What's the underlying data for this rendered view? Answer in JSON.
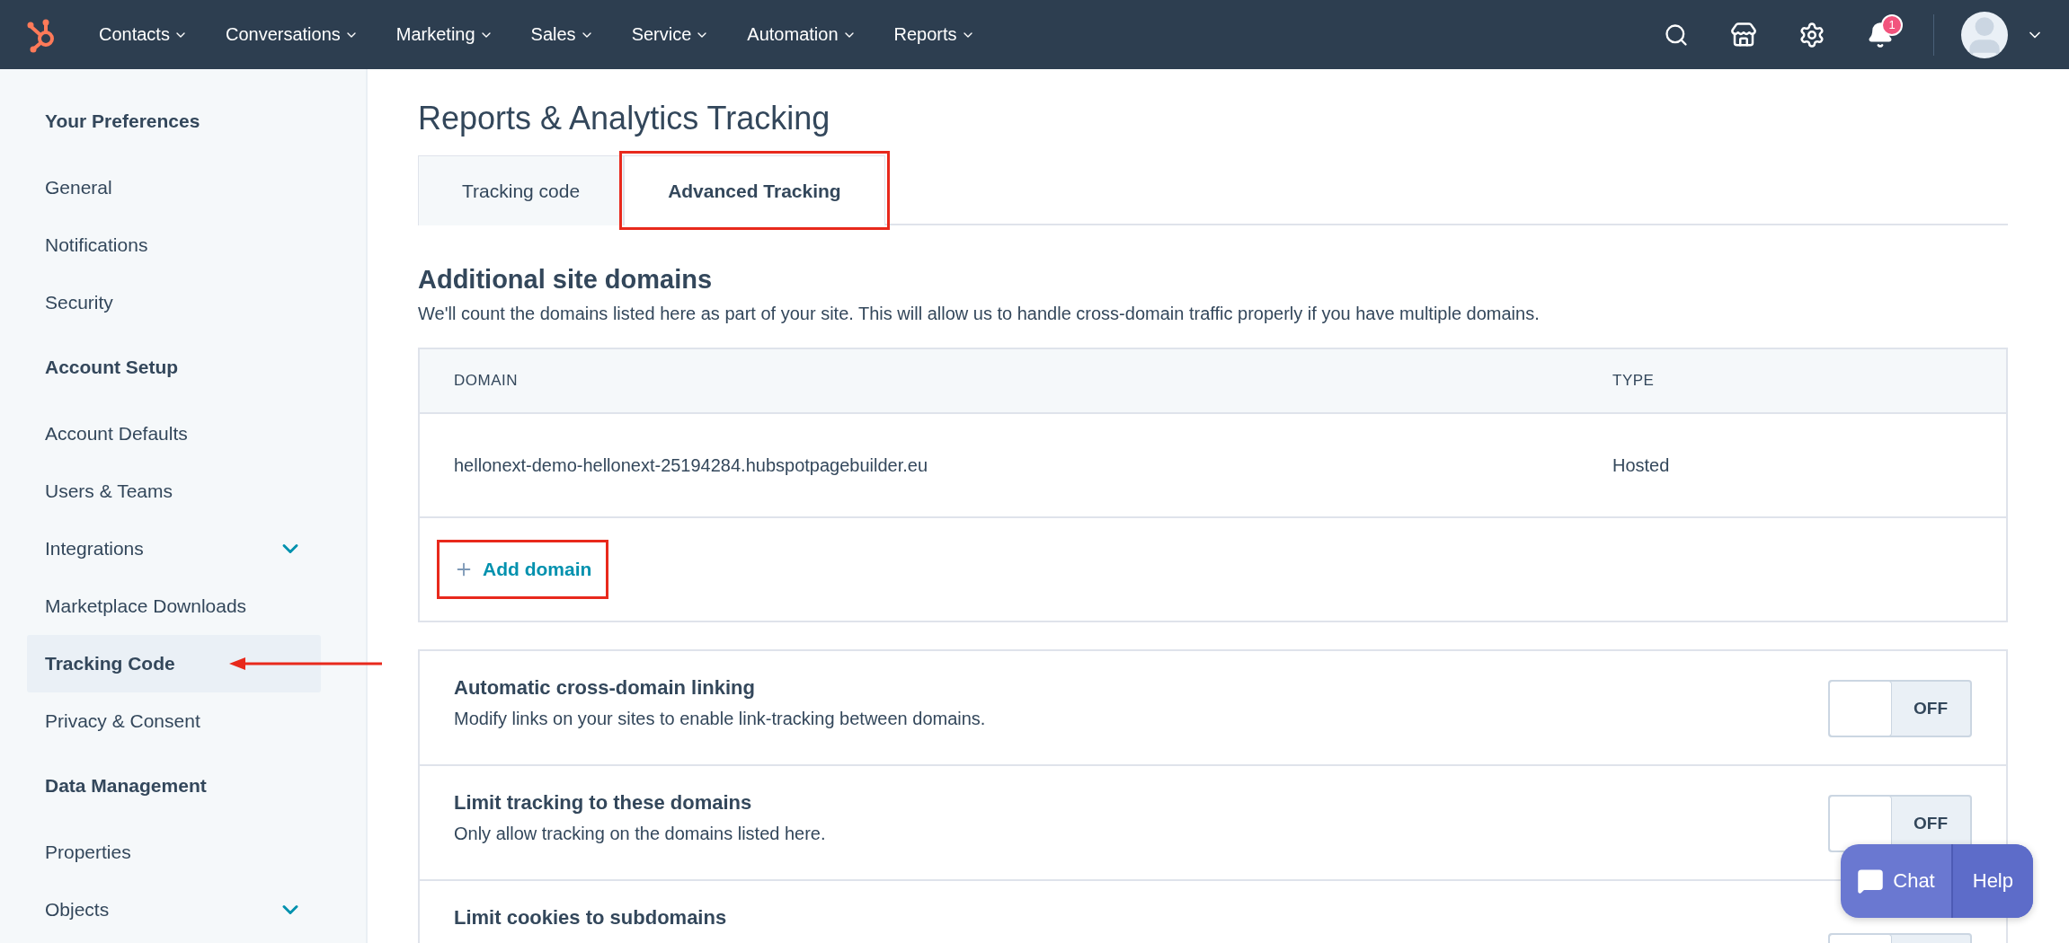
{
  "top_nav": {
    "menus": [
      {
        "label": "Contacts"
      },
      {
        "label": "Conversations"
      },
      {
        "label": "Marketing"
      },
      {
        "label": "Sales"
      },
      {
        "label": "Service"
      },
      {
        "label": "Automation"
      },
      {
        "label": "Reports"
      }
    ],
    "notification_count": "1"
  },
  "sidebar": {
    "sections": [
      {
        "heading": "Your Preferences",
        "items": [
          {
            "label": "General",
            "selected": false,
            "expandable": false,
            "annotated": false
          },
          {
            "label": "Notifications",
            "selected": false,
            "expandable": false,
            "annotated": false
          },
          {
            "label": "Security",
            "selected": false,
            "expandable": false,
            "annotated": false
          }
        ]
      },
      {
        "heading": "Account Setup",
        "items": [
          {
            "label": "Account Defaults",
            "selected": false,
            "expandable": false,
            "annotated": false
          },
          {
            "label": "Users & Teams",
            "selected": false,
            "expandable": false,
            "annotated": false
          },
          {
            "label": "Integrations",
            "selected": false,
            "expandable": true,
            "annotated": false
          },
          {
            "label": "Marketplace Downloads",
            "selected": false,
            "expandable": false,
            "annotated": false
          },
          {
            "label": "Tracking Code",
            "selected": true,
            "expandable": false,
            "annotated": true
          },
          {
            "label": "Privacy & Consent",
            "selected": false,
            "expandable": false,
            "annotated": false
          }
        ]
      },
      {
        "heading": "Data Management",
        "items": [
          {
            "label": "Properties",
            "selected": false,
            "expandable": false,
            "annotated": false
          },
          {
            "label": "Objects",
            "selected": false,
            "expandable": true,
            "annotated": false
          }
        ]
      }
    ]
  },
  "page": {
    "title": "Reports & Analytics Tracking",
    "tabs": [
      {
        "label": "Tracking code",
        "selected": false,
        "annotated": false
      },
      {
        "label": "Advanced Tracking",
        "selected": true,
        "annotated": true
      }
    ],
    "section": {
      "heading": "Additional site domains",
      "description": "We'll count the domains listed here as part of your site. This will allow us to handle cross-domain traffic properly if you have multiple domains."
    },
    "table": {
      "columns": [
        "DOMAIN",
        "TYPE"
      ],
      "rows": [
        [
          "hellonext-demo-hellonext-25194284.hubspotpagebuilder.eu",
          "Hosted"
        ]
      ]
    },
    "add_domain": {
      "label": "Add domain",
      "annotated": true
    },
    "settings": [
      {
        "title": "Automatic cross-domain linking",
        "description": "Modify links on your sites to enable link-tracking between domains.",
        "on": false,
        "toggle_label": "OFF"
      },
      {
        "title": "Limit tracking to these domains",
        "description": "Only allow tracking on the domains listed here.",
        "on": false,
        "toggle_label": "OFF"
      },
      {
        "title": "Limit cookies to subdomains",
        "on": false
      }
    ]
  },
  "chat_widget": {
    "chat": "Chat",
    "help": "Help"
  }
}
